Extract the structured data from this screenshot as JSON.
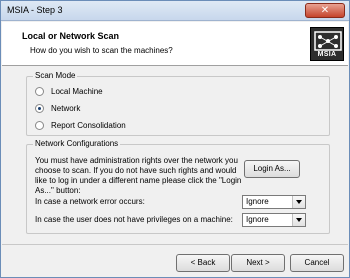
{
  "window": {
    "title": "MSIA - Step 3",
    "close_glyph": "✕"
  },
  "header": {
    "title": "Local or Network Scan",
    "subtitle": "How do you wish to scan the machines?",
    "logo_text": "MSIA"
  },
  "scan_mode": {
    "legend": "Scan Mode",
    "options": [
      {
        "label": "Local Machine",
        "selected": false
      },
      {
        "label": "Network",
        "selected": true
      },
      {
        "label": "Report Consolidation",
        "selected": false
      }
    ]
  },
  "network": {
    "legend": "Network Configurations",
    "description": "You must have administration rights over the network you choose to scan.  If you do not have such rights and would like to log in under a different name please click the \"Login As...\" button:",
    "login_button": "Login As...",
    "error_label": "In case a network error occurs:",
    "error_value": "Ignore",
    "privilege_label": "In case the user does not have privileges on a machine:",
    "privilege_value": "Ignore"
  },
  "footer": {
    "back": "< Back",
    "next": "Next >",
    "cancel": "Cancel"
  }
}
